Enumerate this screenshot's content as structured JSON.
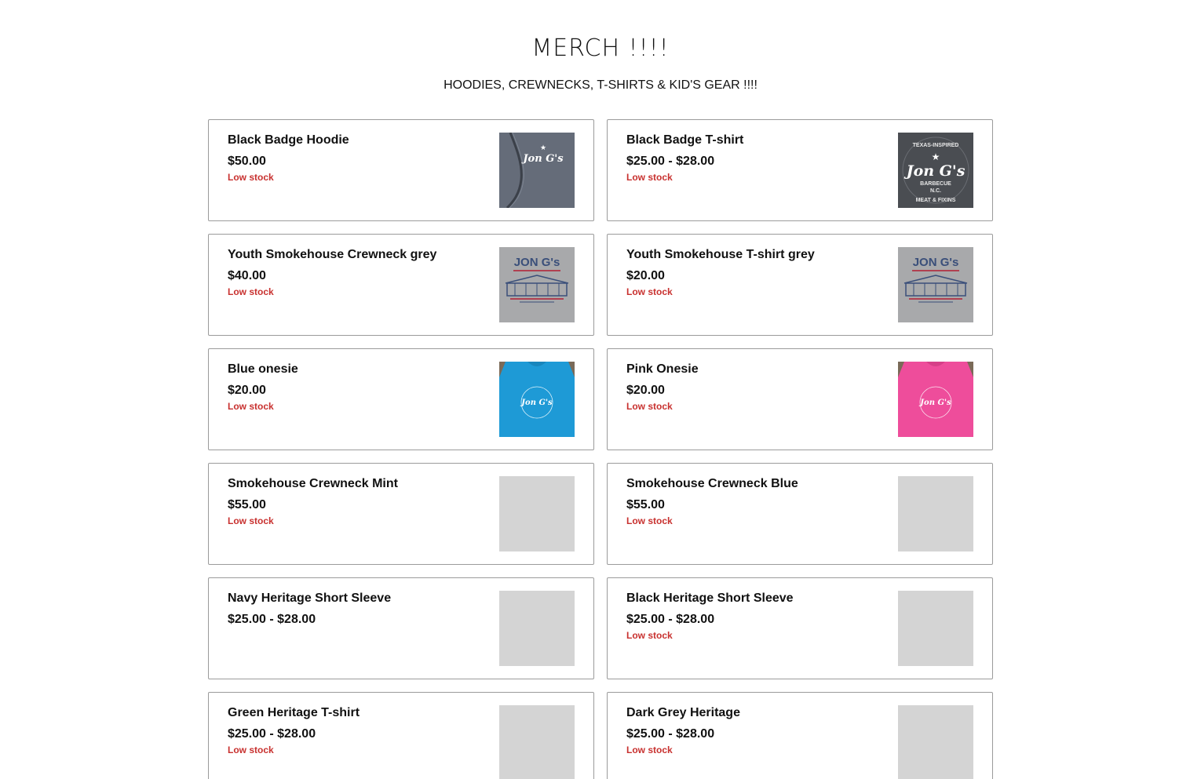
{
  "header": {
    "title": "MERCH !!!!",
    "subtitle": "HOODIES, CREWNECKS, T-SHIRTS & KID'S GEAR !!!!"
  },
  "colors": {
    "low_stock": "#c8312f",
    "border": "#9b9b9b",
    "placeholder": "#d4d4d4"
  },
  "products": [
    {
      "name": "Black Badge Hoodie",
      "price": "$50.00",
      "stock": "Low stock",
      "image": "hoodie-icon"
    },
    {
      "name": "Black Badge T-shirt",
      "price": "$25.00 - $28.00",
      "stock": "Low stock",
      "image": "badge-tshirt-icon"
    },
    {
      "name": "Youth Smokehouse Crewneck grey",
      "price": "$40.00",
      "stock": "Low stock",
      "image": "smokehouse-print-icon"
    },
    {
      "name": "Youth Smokehouse T-shirt grey",
      "price": "$20.00",
      "stock": "Low stock",
      "image": "smokehouse-print-icon"
    },
    {
      "name": "Blue onesie",
      "price": "$20.00",
      "stock": "Low stock",
      "image": "blue-onesie-icon"
    },
    {
      "name": "Pink Onesie",
      "price": "$20.00",
      "stock": "Low stock",
      "image": "pink-onesie-icon"
    },
    {
      "name": "Smokehouse Crewneck Mint",
      "price": "$55.00",
      "stock": "Low stock",
      "image": "image-placeholder"
    },
    {
      "name": "Smokehouse Crewneck Blue",
      "price": "$55.00",
      "stock": "Low stock",
      "image": "image-placeholder"
    },
    {
      "name": "Navy Heritage Short Sleeve",
      "price": "$25.00 - $28.00",
      "stock": "",
      "image": "image-placeholder"
    },
    {
      "name": "Black Heritage Short Sleeve",
      "price": "$25.00 - $28.00",
      "stock": "Low stock",
      "image": "image-placeholder"
    },
    {
      "name": "Green Heritage T-shirt",
      "price": "$25.00 - $28.00",
      "stock": "Low stock",
      "image": "image-placeholder"
    },
    {
      "name": "Dark Grey Heritage",
      "price": "$25.00 - $28.00",
      "stock": "Low stock",
      "image": "image-placeholder"
    }
  ],
  "logos": {
    "script": "Jon G's",
    "smokehouse_title": "JON G's",
    "badge_top": "TEXAS-INSPIRED",
    "badge_mid": "BARBECUE",
    "badge_nc": "N.C.",
    "badge_bottom": "MEAT & FIXINS"
  }
}
